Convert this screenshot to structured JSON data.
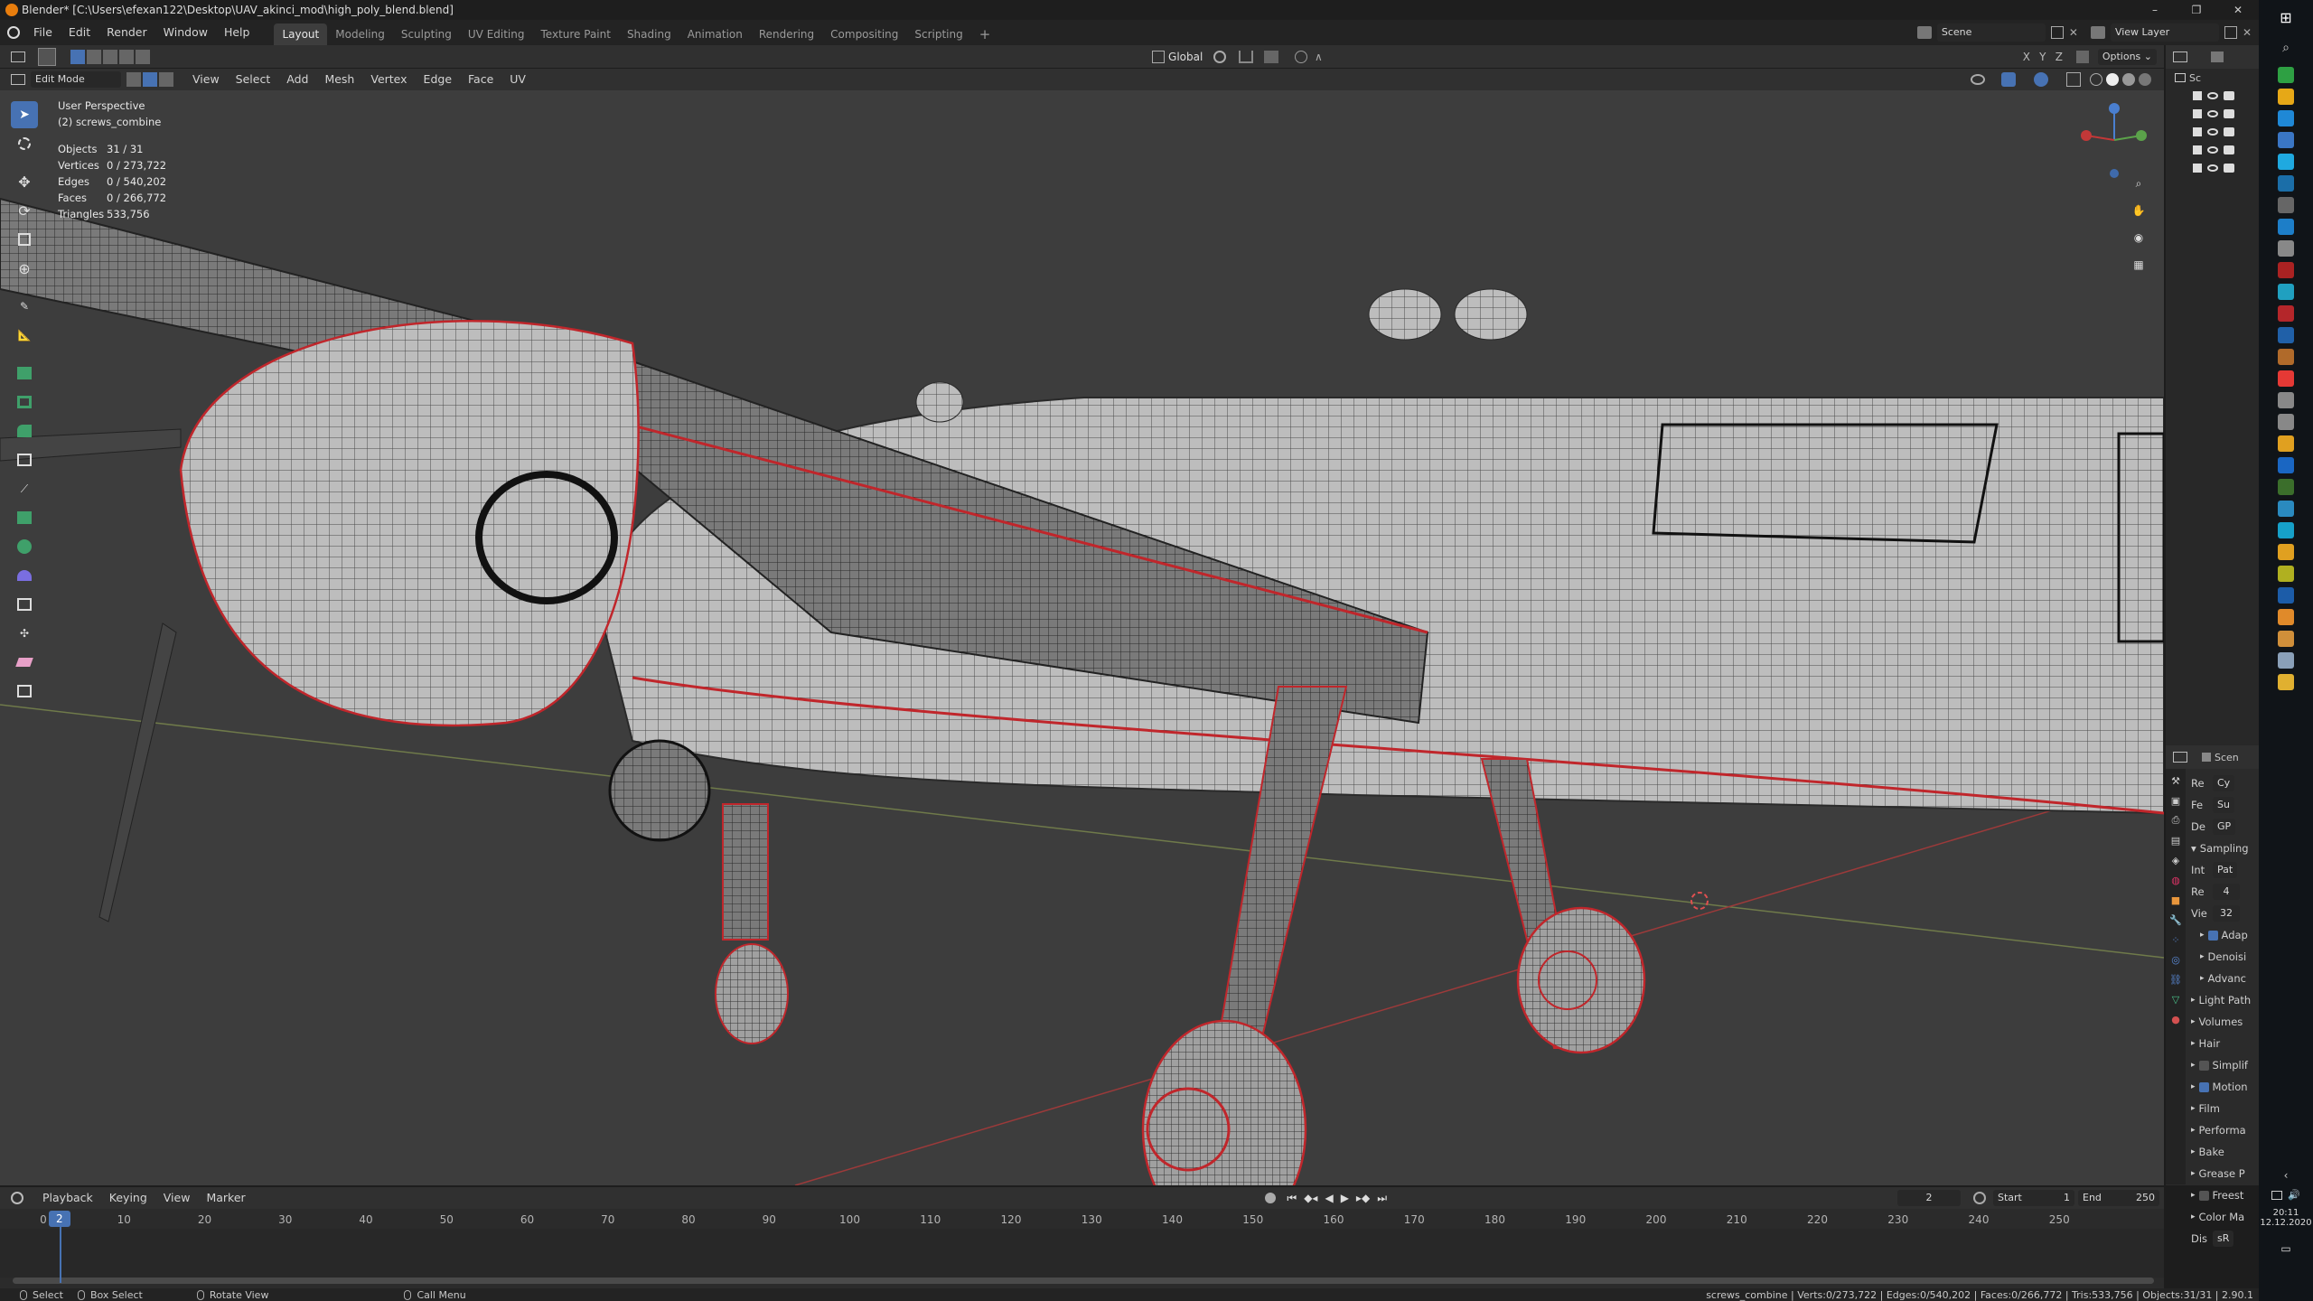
{
  "titlebar": {
    "title": "Blender* [C:\\Users\\efexan122\\Desktop\\UAV_akinci_mod\\high_poly_blend.blend]"
  },
  "menu": [
    "File",
    "Edit",
    "Render",
    "Window",
    "Help"
  ],
  "workspaces": [
    "Layout",
    "Modeling",
    "Sculpting",
    "UV Editing",
    "Texture Paint",
    "Shading",
    "Animation",
    "Rendering",
    "Compositing",
    "Scripting"
  ],
  "active_workspace": "Layout",
  "scene": {
    "label": "Scene",
    "view_layer": "View Layer"
  },
  "header2": {
    "transform": "Global",
    "options": "Options",
    "axes": [
      "X",
      "Y",
      "Z"
    ]
  },
  "viewport_header": {
    "mode": "Edit Mode",
    "menus": [
      "View",
      "Select",
      "Add",
      "Mesh",
      "Vertex",
      "Edge",
      "Face",
      "UV"
    ]
  },
  "overlay": {
    "perspective": "User Perspective",
    "object": "(2) screws_combine",
    "stats": [
      {
        "label": "Objects",
        "value": "31 / 31"
      },
      {
        "label": "Vertices",
        "value": "0 / 273,722"
      },
      {
        "label": "Edges",
        "value": "0 / 540,202"
      },
      {
        "label": "Faces",
        "value": "0 / 266,772"
      },
      {
        "label": "Triangles",
        "value": "533,756"
      }
    ]
  },
  "outliner": {
    "root": "Sc",
    "rows": 5
  },
  "properties": {
    "scene_label": "Scen",
    "rows": [
      {
        "label": "Re",
        "value": "Cy"
      },
      {
        "label": "Fe",
        "value": "Su"
      },
      {
        "label": "De",
        "value": "GP"
      }
    ],
    "sampling": "Sampling",
    "integrator": {
      "label": "Int",
      "value": "Pat"
    },
    "render": {
      "label": "Re",
      "value": "4"
    },
    "viewport": {
      "label": "Vie",
      "value": "32"
    },
    "sub": [
      {
        "label": "Adap",
        "check": true
      },
      {
        "label": "Denoisi",
        "check": null
      },
      {
        "label": "Advanc",
        "check": null
      }
    ],
    "panels": [
      {
        "label": "Light Path",
        "check": null
      },
      {
        "label": "Volumes",
        "check": null
      },
      {
        "label": "Hair",
        "check": null
      },
      {
        "label": "Simplif",
        "check": false
      },
      {
        "label": "Motion",
        "check": true
      },
      {
        "label": "Film",
        "check": null
      },
      {
        "label": "Performa",
        "check": null
      },
      {
        "label": "Bake",
        "check": null
      },
      {
        "label": "Grease P",
        "check": null
      },
      {
        "label": "Freest",
        "check": false
      },
      {
        "label": "Color Ma",
        "check": null
      }
    ],
    "display": {
      "label": "Dis",
      "value": "sR"
    }
  },
  "timeline": {
    "menus": [
      "Playback",
      "Keying",
      "View",
      "Marker"
    ],
    "current_frame": "2",
    "start_label": "Start",
    "start": "1",
    "end_label": "End",
    "end": "250",
    "ticks": [
      "0",
      "10",
      "20",
      "30",
      "40",
      "50",
      "60",
      "70",
      "80",
      "90",
      "100",
      "110",
      "120",
      "130",
      "140",
      "150",
      "160",
      "170",
      "180",
      "190",
      "200",
      "210",
      "220",
      "230",
      "240",
      "250"
    ],
    "playhead": "2"
  },
  "statusbar": {
    "select": "Select",
    "box_select": "Box Select",
    "rotate": "Rotate View",
    "call_menu": "Call Menu",
    "info": "screws_combine | Verts:0/273,722 | Edges:0/540,202 | Faces:0/266,772 | Tris:533,756 | Objects:31/31 | 2.90.1"
  },
  "taskbar": {
    "time": "20:11",
    "date": "12.12.2020"
  },
  "colors": {
    "accent": "#4772b3",
    "viewport_bg": "#3d3d3d",
    "seam_red": "#c0262b",
    "panel": "#303030"
  }
}
